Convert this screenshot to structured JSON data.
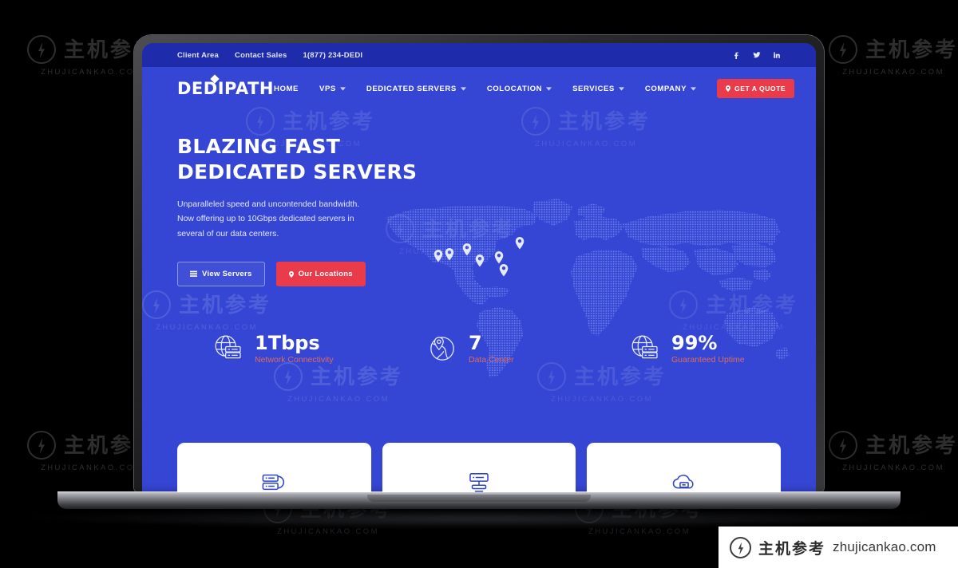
{
  "topbar": {
    "links": [
      {
        "label": "Client Area"
      },
      {
        "label": "Contact Sales"
      },
      {
        "label": "1(877) 234-DEDI"
      }
    ],
    "social": [
      {
        "name": "facebook-icon"
      },
      {
        "name": "twitter-icon"
      },
      {
        "name": "linkedin-icon"
      }
    ],
    "bg_color": "#1e2bab"
  },
  "nav": {
    "logo_text": "DEDIPATH",
    "items": [
      {
        "label": "HOME",
        "has_caret": false
      },
      {
        "label": "VPS",
        "has_caret": true
      },
      {
        "label": "DEDICATED SERVERS",
        "has_caret": true
      },
      {
        "label": "COLOCATION",
        "has_caret": true
      },
      {
        "label": "SERVICES",
        "has_caret": true
      },
      {
        "label": "COMPANY",
        "has_caret": true
      }
    ],
    "quote_button": "GET A QUOTE",
    "quote_color": "#ea3b4a"
  },
  "hero": {
    "title_line1": "BLAZING FAST",
    "title_line2": "DEDICATED SERVERS",
    "subtitle": "Unparalleled speed and uncontended bandwidth. Now offering up to 10Gbps dedicated servers in several of our data centers.",
    "buttons": [
      {
        "label": "View Servers",
        "icon": "grid-icon",
        "style": "ghost"
      },
      {
        "label": "Our Locations",
        "icon": "pin-icon",
        "style": "red"
      }
    ],
    "bg_color": "#3546d4",
    "map": {
      "name": "dotted-world-map",
      "pin_count": 7,
      "dot_color": "#5f74e8"
    }
  },
  "stats": [
    {
      "value": "1Tbps",
      "label": "Network Connectivity",
      "icon": "globe-server-icon"
    },
    {
      "value": "7",
      "label": "Data Center",
      "icon": "globe-pin-icon"
    },
    {
      "value": "99%",
      "label": "Guaranteed Uptime",
      "icon": "globe-server-icon"
    }
  ],
  "stat_label_color": "#e06a5e",
  "cards": [
    {
      "icon": "server-stack-icon"
    },
    {
      "icon": "server-tower-icon"
    },
    {
      "icon": "cloud-server-icon"
    }
  ],
  "watermark": {
    "cn": "主机参考",
    "en": "ZHUJICANKAO.COM"
  },
  "badge": {
    "cn": "主机参考",
    "domain": "zhujicankao.com"
  }
}
